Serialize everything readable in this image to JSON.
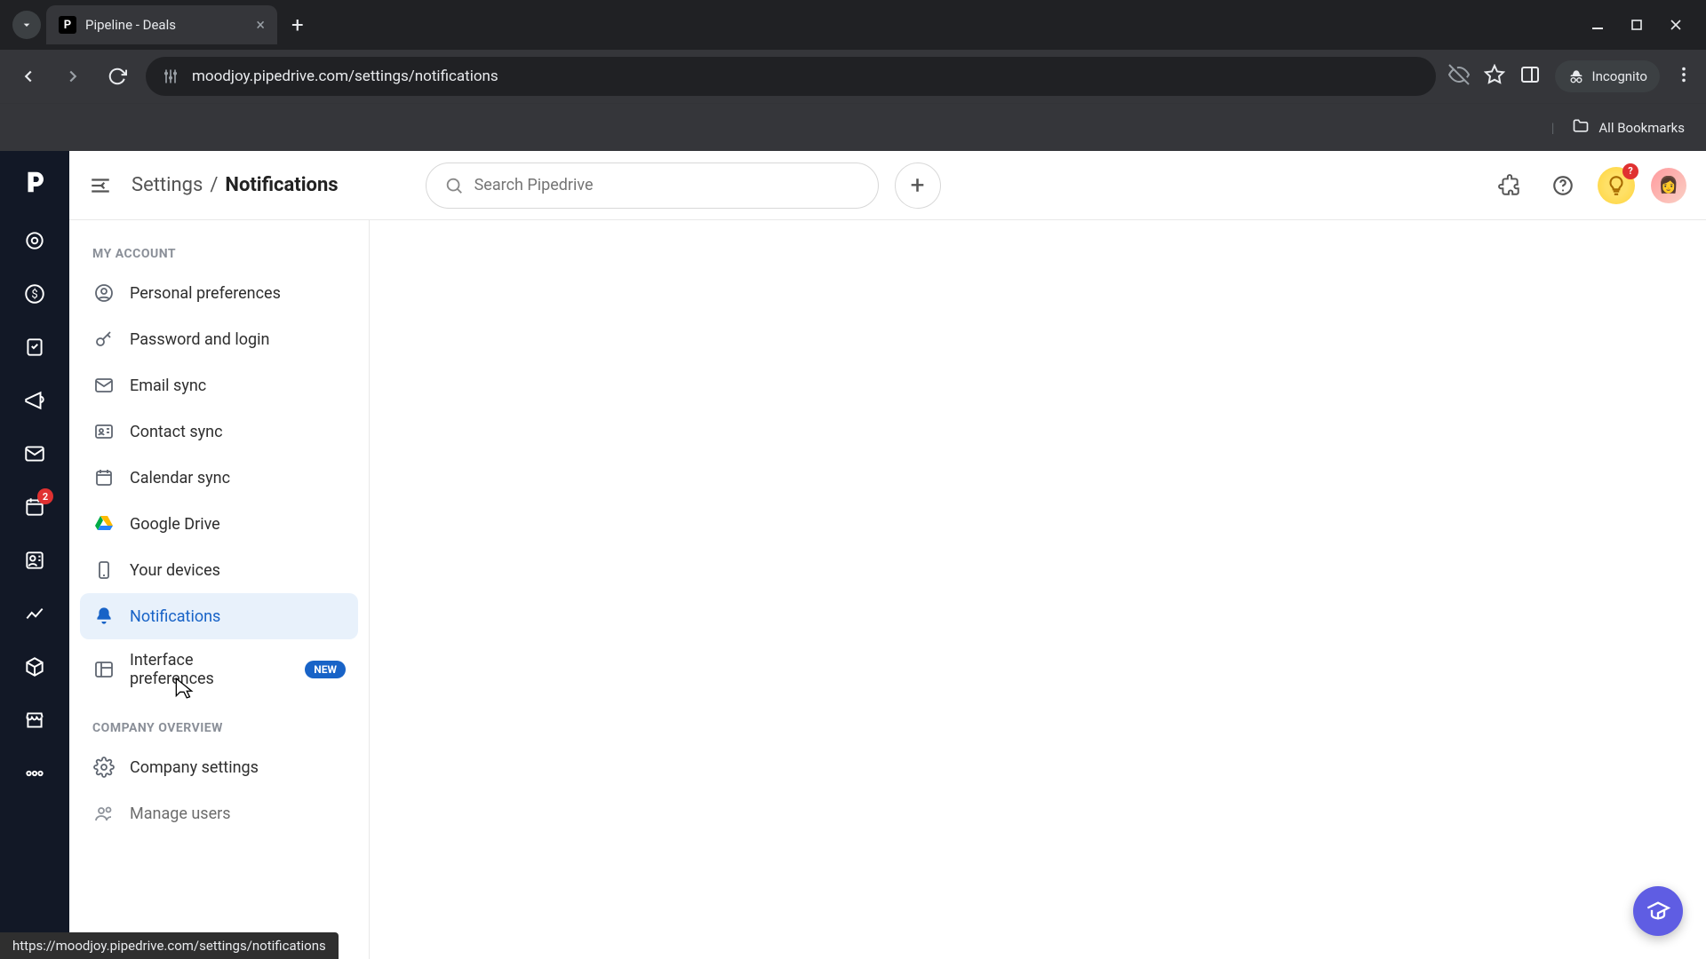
{
  "browser": {
    "tab_title": "Pipeline - Deals",
    "url": "moodjoy.pipedrive.com/settings/notifications",
    "incognito_label": "Incognito",
    "all_bookmarks": "All Bookmarks",
    "status_url": "https://moodjoy.pipedrive.com/settings/notifications"
  },
  "header": {
    "breadcrumb_root": "Settings",
    "breadcrumb_sep": "/",
    "breadcrumb_current": "Notifications",
    "search_placeholder": "Search Pipedrive",
    "tips_badge": "?"
  },
  "rail": {
    "activity_badge": "2"
  },
  "sidenav": {
    "group_account": "MY ACCOUNT",
    "items_account": [
      {
        "label": "Personal preferences",
        "icon": "user"
      },
      {
        "label": "Password and login",
        "icon": "key"
      },
      {
        "label": "Email sync",
        "icon": "mail"
      },
      {
        "label": "Contact sync",
        "icon": "contact"
      },
      {
        "label": "Calendar sync",
        "icon": "calendar"
      },
      {
        "label": "Google Drive",
        "icon": "gdrive"
      },
      {
        "label": "Your devices",
        "icon": "device"
      },
      {
        "label": "Notifications",
        "icon": "bell",
        "active": true
      },
      {
        "label": "Interface preferences",
        "icon": "layout",
        "badge": "NEW"
      }
    ],
    "group_company": "COMPANY OVERVIEW",
    "items_company": [
      {
        "label": "Company settings",
        "icon": "gear"
      },
      {
        "label": "Manage users",
        "icon": "users"
      }
    ]
  }
}
